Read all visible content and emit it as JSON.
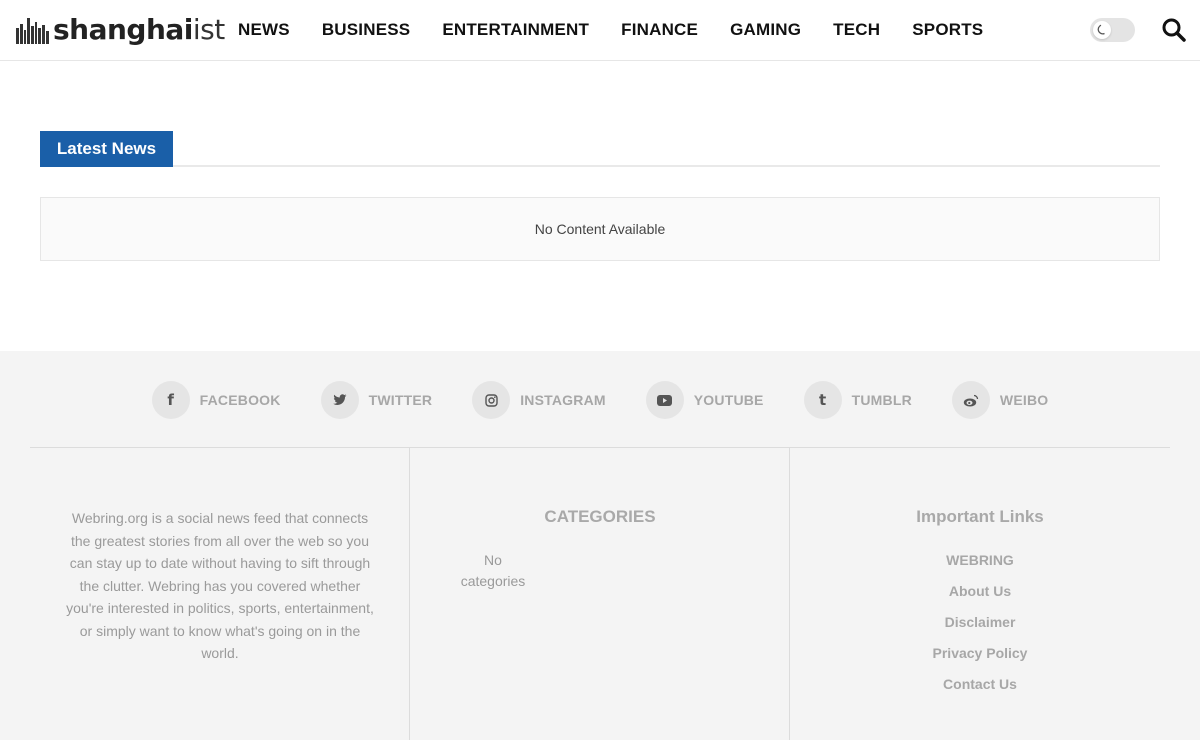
{
  "header": {
    "logo_bold": "shanghai",
    "logo_light": "ist",
    "nav": [
      "NEWS",
      "BUSINESS",
      "ENTERTAINMENT",
      "FINANCE",
      "GAMING",
      "TECH",
      "SPORTS"
    ]
  },
  "main": {
    "section_title": "Latest News",
    "empty_message": "No Content Available"
  },
  "footer": {
    "social": [
      {
        "label": "FACEBOOK",
        "icon": "facebook-icon",
        "glyph": "f"
      },
      {
        "label": "TWITTER",
        "icon": "twitter-icon",
        "glyph": ""
      },
      {
        "label": "INSTAGRAM",
        "icon": "instagram-icon",
        "glyph": ""
      },
      {
        "label": "YOUTUBE",
        "icon": "youtube-icon",
        "glyph": ""
      },
      {
        "label": "TUMBLR",
        "icon": "tumblr-icon",
        "glyph": "t"
      },
      {
        "label": "WEIBO",
        "icon": "weibo-icon",
        "glyph": ""
      }
    ],
    "about_text": "Webring.org is a social news feed that connects the greatest stories from all over the web so you can stay up to date without having to sift through the clutter. Webring has you covered whether you're interested in politics, sports, entertainment, or simply want to know what's going on in the world.",
    "categories_title": "CATEGORIES",
    "no_categories": "No categories",
    "links_title": "Important Links",
    "links": [
      "WEBRING",
      "About Us",
      "Disclaimer",
      "Privacy Policy",
      "Contact Us"
    ]
  },
  "colors": {
    "accent": "#1a5fa8",
    "footer_bg": "#f4f4f4",
    "footer_text": "#a7a7a7"
  }
}
